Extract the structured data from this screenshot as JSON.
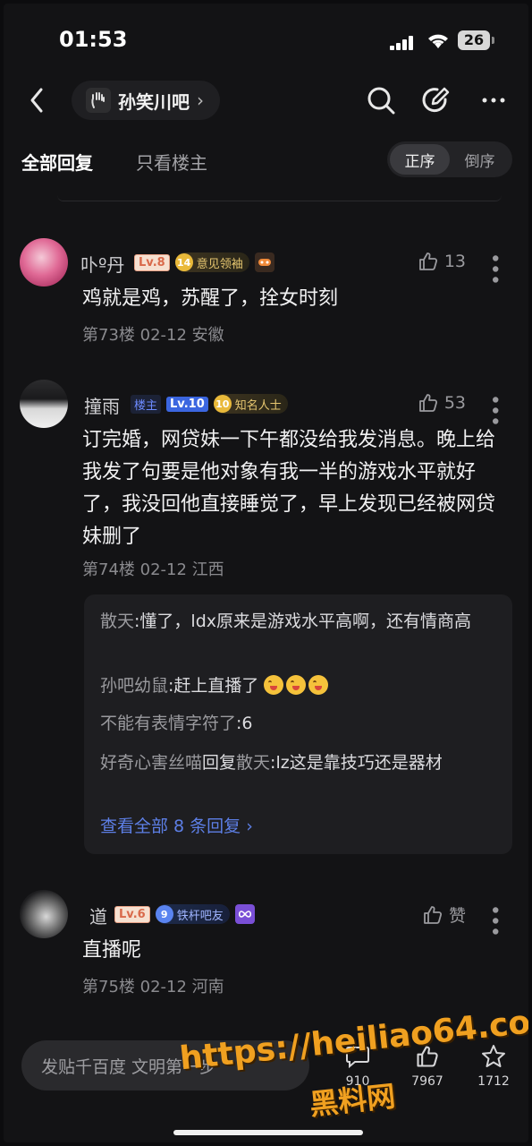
{
  "status": {
    "time": "01:53",
    "battery": "26"
  },
  "nav": {
    "forum_name": "孙笑川吧",
    "chevron": "›"
  },
  "tabs": {
    "all_replies": "全部回复",
    "only_op": "只看楼主",
    "sort_asc": "正序",
    "sort_desc": "倒序"
  },
  "posts": [
    {
      "username": "卟º丹",
      "level": "Lv.8",
      "medal_num": "14",
      "medal_label": "意见领袖",
      "likes": "13",
      "content": "鸡就是鸡，苏醒了，拴女时刻",
      "meta": "第73楼 02-12 安徽"
    },
    {
      "username": "撞雨",
      "host_label": "楼主",
      "level": "Lv.10",
      "medal_num": "10",
      "medal_label": "知名人士",
      "likes": "53",
      "content": "订完婚，网贷妹一下午都没给我发消息。晚上给我发了句要是他对象有我一半的游戏水平就好了，我没回他直接睡觉了，早上发现已经被网贷妹删了",
      "meta": "第74楼 02-12 江西"
    },
    {
      "username": "道",
      "level": "Lv.6",
      "medal_num": "9",
      "medal_label": "铁杆吧友",
      "likes": "赞",
      "content": "直播呢",
      "meta": "第75楼 02-12 河南"
    }
  ],
  "subreplies": [
    {
      "who": "散天",
      "text": ":懂了，ldx原来是游戏水平高啊，还有情商高"
    },
    {
      "who": "孙吧幼鼠",
      "text": ":赶上直播了"
    },
    {
      "who": "不能有表情字符了",
      "text": ":6"
    },
    {
      "who": "好奇心害丝喵",
      "reply_kw": "回复",
      "target": "散天",
      "text": ":lz这是靠技巧还是器材"
    }
  ],
  "view_all": "查看全部 8 条回复 ›",
  "bottom": {
    "placeholder": "发贴千百度 文明第一步",
    "count1": "910",
    "count2": "7967",
    "count3": "1712"
  },
  "watermark": {
    "line1": "https://heiliao64.com",
    "line2": "黑料网"
  }
}
